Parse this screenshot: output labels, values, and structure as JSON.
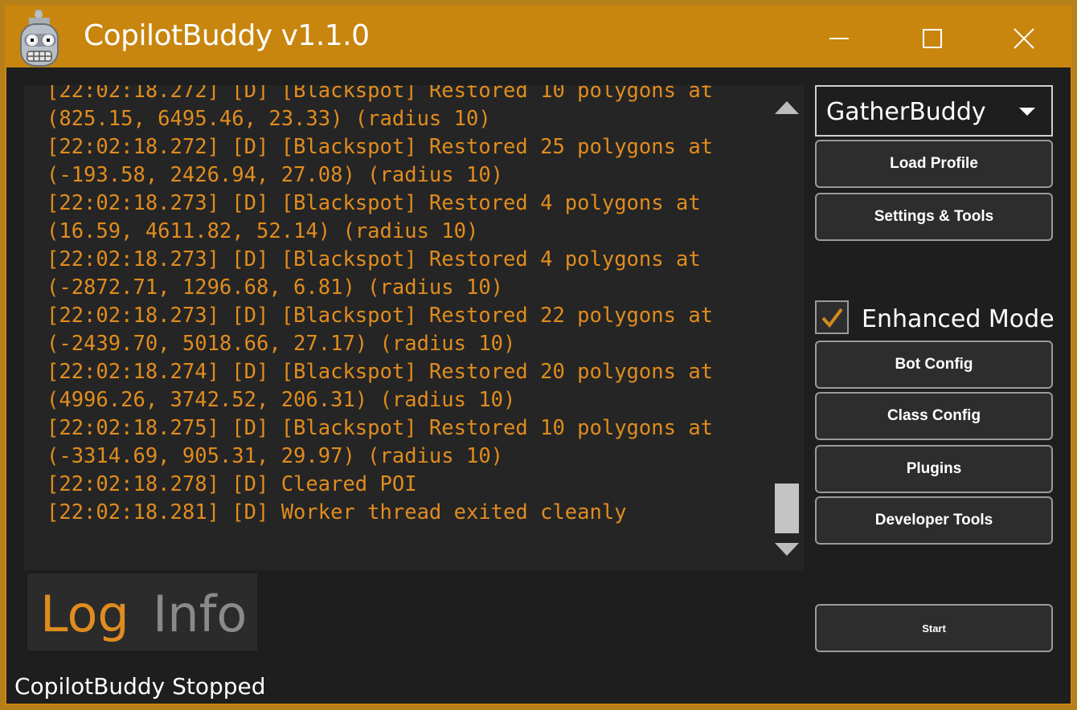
{
  "window": {
    "title": "CopilotBuddy v1.1.0",
    "accent_color": "#c8860f",
    "log_color": "#e08c1f",
    "controls": [
      "minimize-icon",
      "maximize-icon",
      "close-icon"
    ]
  },
  "log": {
    "lines": [
      "[22:02:18.272] [D] [Blackspot] Restored 10 polygons at",
      "(825.15, 6495.46, 23.33) (radius 10)",
      "[22:02:18.272] [D] [Blackspot] Restored 25 polygons at",
      "(-193.58, 2426.94, 27.08) (radius 10)",
      "[22:02:18.273] [D] [Blackspot] Restored 4 polygons at",
      "(16.59, 4611.82, 52.14) (radius 10)",
      "[22:02:18.273] [D] [Blackspot] Restored 4 polygons at",
      "(-2872.71, 1296.68, 6.81) (radius 10)",
      "[22:02:18.273] [D] [Blackspot] Restored 22 polygons at",
      "(-2439.70, 5018.66, 27.17) (radius 10)",
      "[22:02:18.274] [D] [Blackspot] Restored 20 polygons at",
      "(4996.26, 3742.52, 206.31) (radius 10)",
      "[22:02:18.275] [D] [Blackspot] Restored 10 polygons at",
      "(-3314.69, 905.31, 29.97) (radius 10)",
      "[22:02:18.278] [D] Cleared POI",
      "[22:02:18.281] [D] Worker thread exited cleanly"
    ]
  },
  "tabs": {
    "log": "Log",
    "info": "Info"
  },
  "status": "CopilotBuddy Stopped",
  "sidebar": {
    "bot_selector": "GatherBuddy",
    "load_profile": "Load Profile",
    "settings_tools": "Settings & Tools",
    "enhanced_mode": {
      "label": "Enhanced Mode",
      "checked": true
    },
    "bot_config": "Bot Config",
    "class_config": "Class Config",
    "plugins": "Plugins",
    "developer_tools": "Developer Tools",
    "start": "Start"
  }
}
